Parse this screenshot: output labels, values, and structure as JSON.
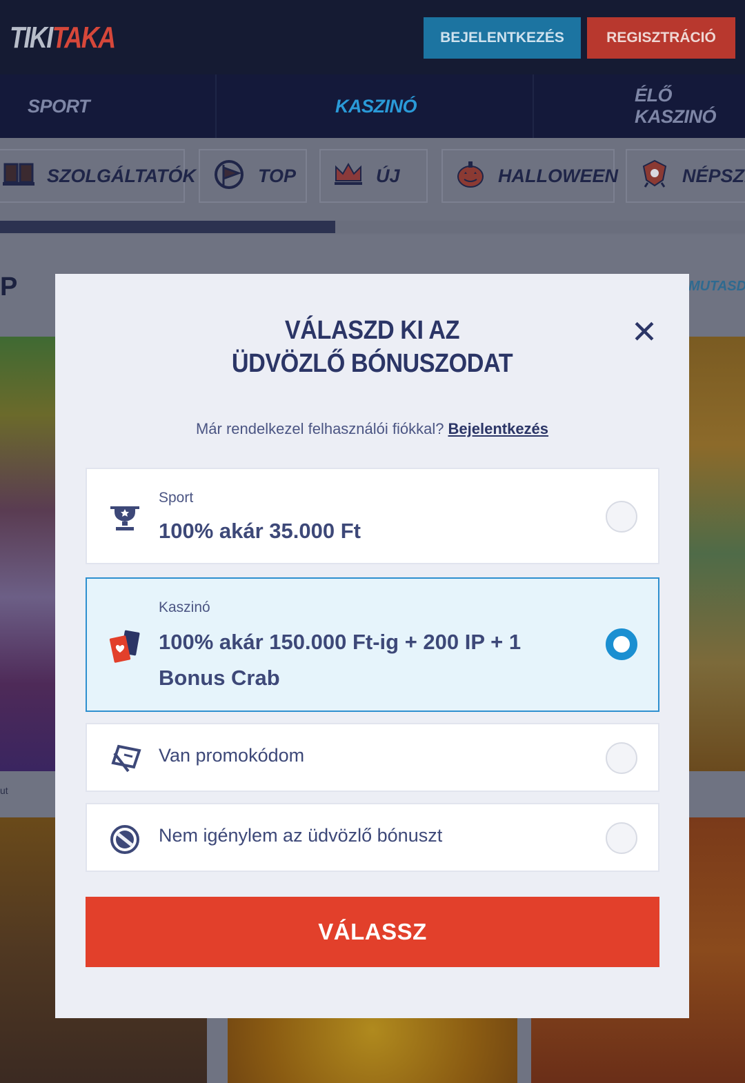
{
  "header": {
    "logo_part1": "TIKI",
    "logo_part2": "TAKA",
    "login_label": "BEJELENTKEZÉS",
    "register_label": "REGISZTRÁCIÓ"
  },
  "main_nav": [
    {
      "label": "SPORT",
      "active": false
    },
    {
      "label": "KASZINÓ",
      "active": true
    },
    {
      "label": "ÉLŐ KASZINÓ",
      "active": false
    }
  ],
  "categories": [
    {
      "label": "SZOLGÁLTATÓK",
      "icon": "book-icon"
    },
    {
      "label": "TOP",
      "icon": "flag-icon"
    },
    {
      "label": "ÚJ",
      "icon": "crown-icon"
    },
    {
      "label": "HALLOWEEN",
      "icon": "pumpkin-icon"
    },
    {
      "label": "NÉPSZE",
      "icon": "badge-icon"
    }
  ],
  "category_scroll_progress": 0.45,
  "background": {
    "section_title": "P",
    "show_all": "MUTASD",
    "small_text": "ut"
  },
  "modal": {
    "title_line1": "VÁLASZD KI AZ",
    "title_line2": "ÜDVÖZLŐ BÓNUSZODAT",
    "login_prompt": "Már rendelkezel felhasználói fiókkal?",
    "login_link": "Bejelentkezés",
    "options": [
      {
        "category": "Sport",
        "text": "100% akár 35.000 Ft",
        "icon": "trophy-icon",
        "selected": false
      },
      {
        "category": "Kaszinó",
        "text_line1": "100% akár 150.000 Ft-ig + 200 IP + 1",
        "text_line2": "Bonus Crab",
        "icon": "cards-icon",
        "selected": true
      },
      {
        "text": "Van promokódom",
        "icon": "ticket-icon",
        "selected": false
      },
      {
        "text": "Nem igénylem az üdvözlő bónuszt",
        "icon": "no-icon",
        "selected": false
      }
    ],
    "cta_label": "VÁLASSZ"
  },
  "colors": {
    "accent_blue": "#1b8fd1",
    "cta_red": "#e2402b",
    "header_bg": "#151b33"
  }
}
